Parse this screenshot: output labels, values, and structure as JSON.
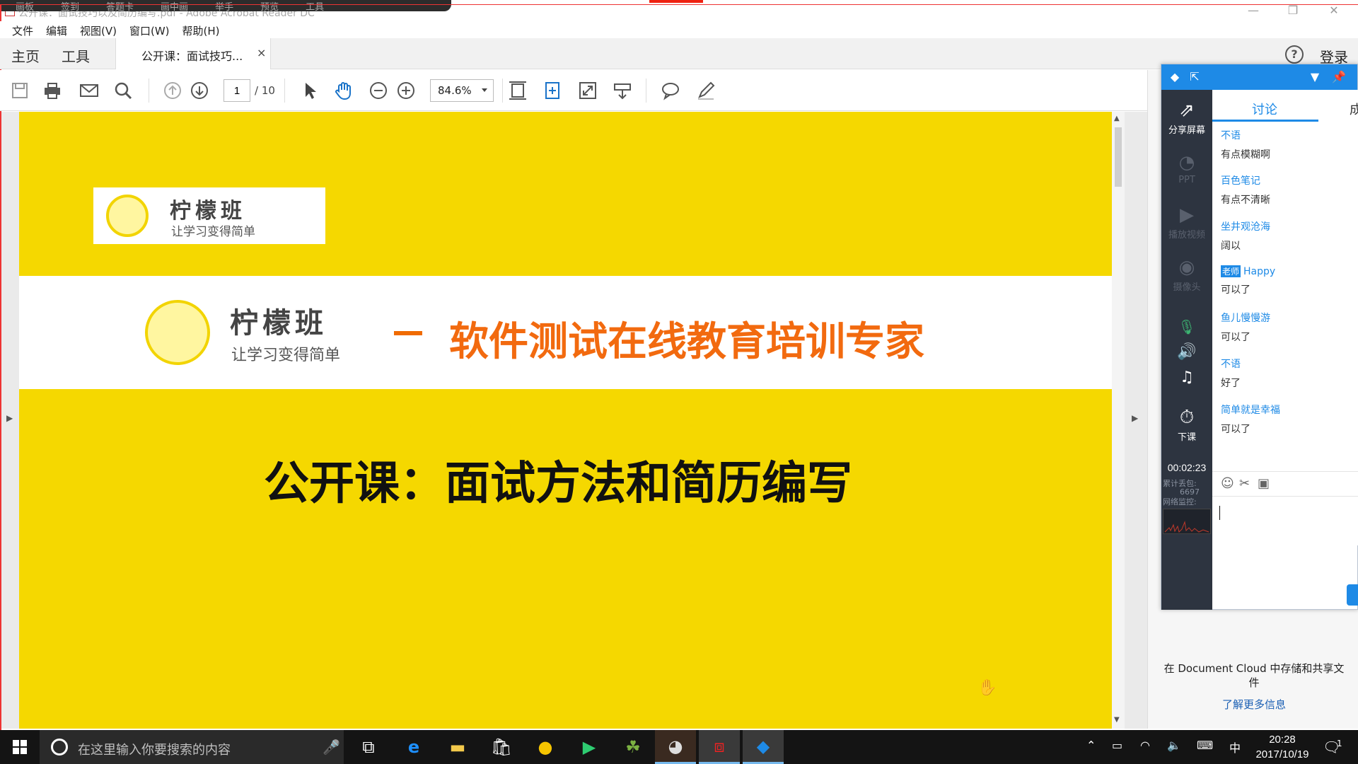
{
  "window": {
    "title": "公开课：面试技巧以及简历编写.pdf - Adobe Acrobat Reader DC",
    "overlay_items": [
      "画板",
      "签到",
      "答题卡",
      "画中画",
      "举手",
      "预览",
      "工具"
    ],
    "minimize": "—",
    "restore": "❐",
    "close": "✕"
  },
  "menu": [
    "文件",
    "编辑",
    "视图(V)",
    "窗口(W)",
    "帮助(H)"
  ],
  "tabs": {
    "home": "主页",
    "tools": "工具",
    "document": "公开课：面试技巧...",
    "close": "×",
    "help": "?",
    "login": "登录"
  },
  "toolbar": {
    "current_page": "1",
    "total_pages": "/ 10",
    "zoom": "84.6%",
    "icons": [
      "save-icon",
      "print-icon",
      "mail-icon",
      "search-icon",
      "page-up-icon",
      "page-down-icon",
      "pointer-icon",
      "hand-icon",
      "zoom-out-icon",
      "zoom-in-icon",
      "fit-page-icon",
      "fit-width-icon",
      "fullscreen-icon",
      "scroll-mode-icon",
      "comment-icon",
      "pen-icon"
    ]
  },
  "document": {
    "logo_name": "柠檬班",
    "logo_slogan": "让学习变得简单",
    "tagline": "软件测试在线教育培训专家",
    "title": "公开课：面试方法和简历编写",
    "colors": {
      "page_yellow": "#f5d800",
      "tagline_orange": "#f26a0f"
    }
  },
  "right_pane": {
    "cloud_text": "在 Document Cloud 中存储和共享文件",
    "cloud_link": "了解更多信息"
  },
  "widget": {
    "side": {
      "share_screen": "分享屏幕",
      "ppt": "PPT",
      "play_video": "播放视频",
      "camera": "摄像头",
      "end_class": "下课",
      "timer": "00:02:23",
      "packet_loss_label": "累计丢包:",
      "packet_loss_value": "6697",
      "network_label": "网络监控:"
    },
    "tabs": {
      "discuss": "讨论",
      "more": "成"
    },
    "messages": [
      {
        "user": "不语",
        "text": "有点模糊啊"
      },
      {
        "user": "百色笔记",
        "text": "有点不清晰"
      },
      {
        "user": "坐井观沧海",
        "text": "阔以"
      },
      {
        "badge": "老师",
        "user": "Happy",
        "text": "可以了"
      },
      {
        "user": "鱼儿慢慢游",
        "text": "可以了"
      },
      {
        "user": "不语",
        "text": "好了"
      },
      {
        "user": "简单就是幸福",
        "text": "可以了"
      }
    ],
    "accent": "#1e8ae6"
  },
  "taskbar": {
    "search_placeholder": "在这里输入你要搜索的内容",
    "ime": "中",
    "time": "20:28",
    "date": "2017/10/19",
    "notifications": "1"
  }
}
